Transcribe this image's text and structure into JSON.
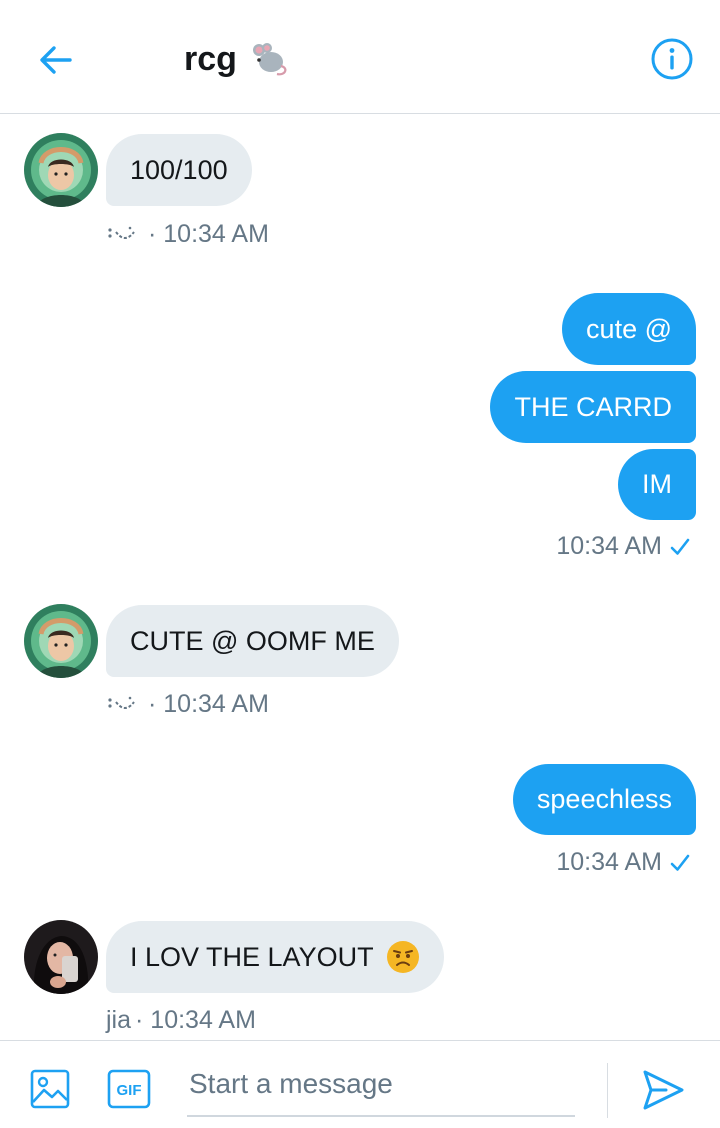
{
  "header": {
    "title": "rcg",
    "title_emoji": "mouse-emoji",
    "back_icon": "arrow-left-icon",
    "info_icon": "info-icon"
  },
  "messages": [
    {
      "side": "in",
      "text": "100/100",
      "meta": "· 10:34 AM",
      "sender_glyph": "smile-emoticon"
    },
    {
      "side": "out",
      "text": "cute @"
    },
    {
      "side": "out",
      "text": "THE CARRD"
    },
    {
      "side": "out",
      "text": "IM",
      "meta": "10:34 AM",
      "status": "sent-check"
    },
    {
      "side": "in",
      "text": "CUTE @ OOMF ME",
      "meta": "· 10:34 AM",
      "sender_glyph": "smile-emoticon"
    },
    {
      "side": "out",
      "text": "speechless",
      "meta": "10:34 AM",
      "status": "sent-check"
    },
    {
      "side": "in",
      "text": "I LOV THE LAYOUT",
      "emoji": "confused-face-emoji",
      "sender": "jia",
      "meta": "· 10:34 AM"
    }
  ],
  "composer": {
    "placeholder": "Start a message",
    "gif_label": "GIF",
    "image_icon": "image-icon",
    "send_icon": "send-icon"
  },
  "colors": {
    "accent": "#1da1f2",
    "incoming_bubble": "#e6ecf0",
    "meta_text": "#657786"
  }
}
